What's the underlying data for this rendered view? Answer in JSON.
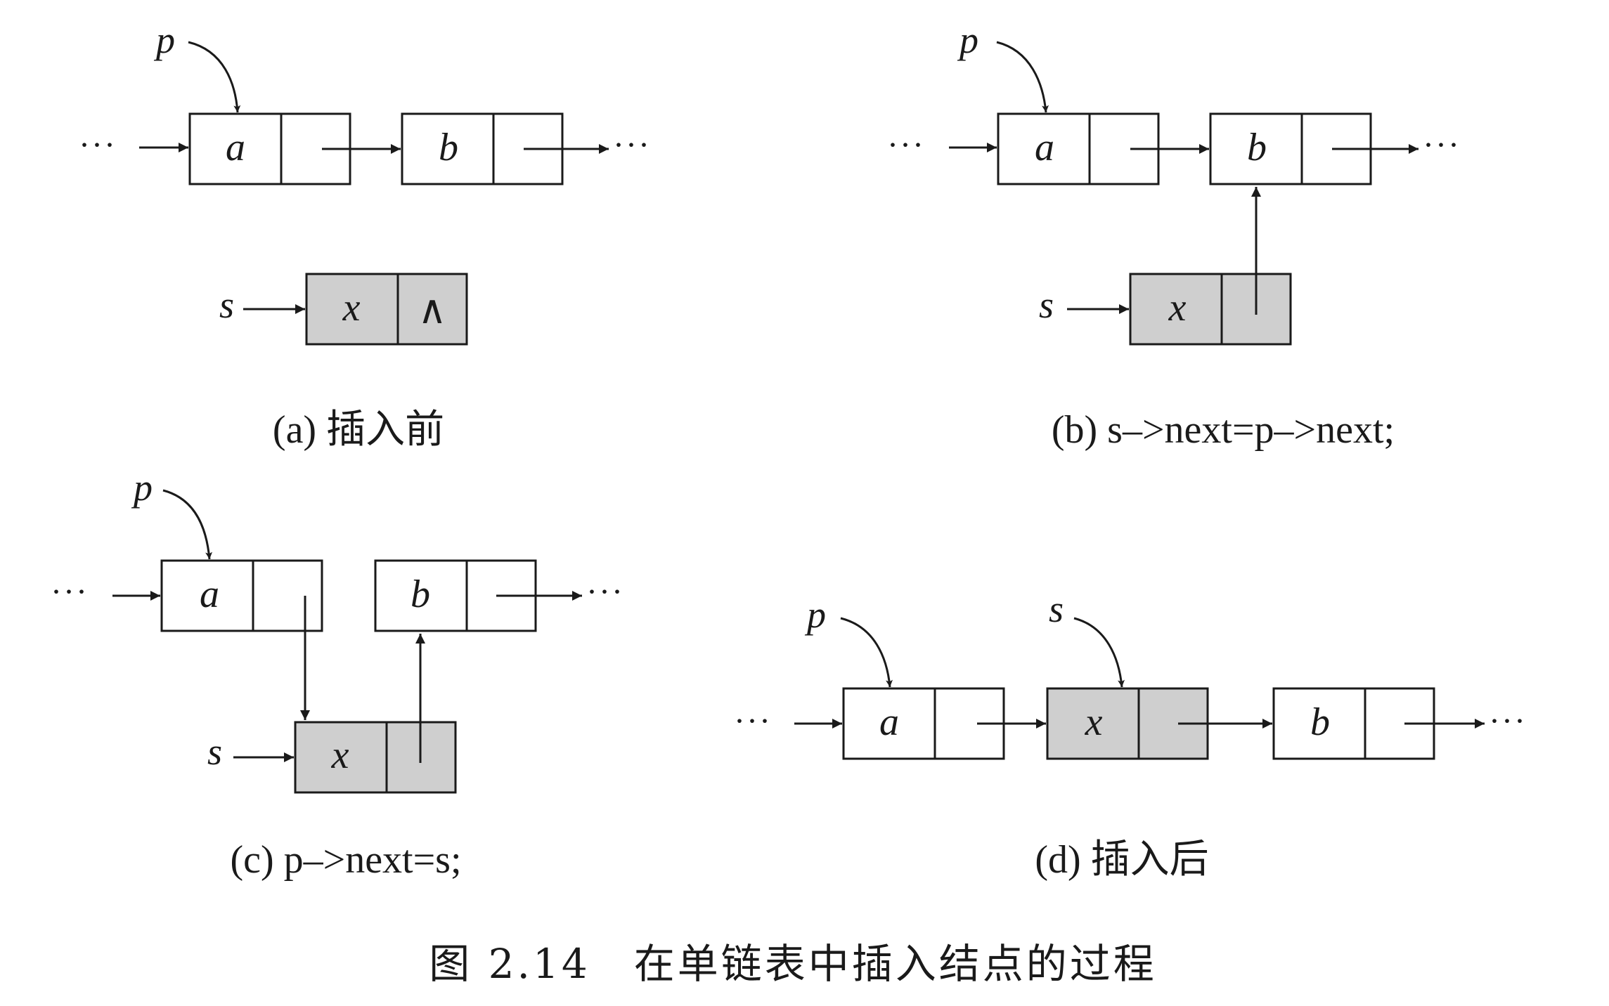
{
  "panels": {
    "a": {
      "caption": "(a) 插入前",
      "node_a": "a",
      "node_b": "b",
      "node_x": "x",
      "pointer_p": "p",
      "pointer_s": "s",
      "null_symbol": "∧",
      "dots": "···"
    },
    "b": {
      "caption": "(b) s–>next=p–>next;",
      "node_a": "a",
      "node_b": "b",
      "node_x": "x",
      "pointer_p": "p",
      "pointer_s": "s",
      "dots": "···"
    },
    "c": {
      "caption": "(c) p–>next=s;",
      "node_a": "a",
      "node_b": "b",
      "node_x": "x",
      "pointer_p": "p",
      "pointer_s": "s",
      "dots": "···"
    },
    "d": {
      "caption": "(d) 插入后",
      "node_a": "a",
      "node_b": "b",
      "node_x": "x",
      "pointer_p": "p",
      "pointer_s": "s",
      "dots": "···"
    }
  },
  "figure_caption": "图 2.14　在单链表中插入结点的过程",
  "colors": {
    "stroke": "#1a1a1a",
    "node_fill": "#ffffff",
    "inserted_node_fill": "#cfcfcf"
  }
}
